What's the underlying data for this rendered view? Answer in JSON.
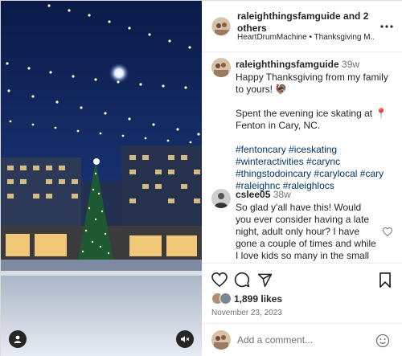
{
  "header": {
    "account": "raleighthingsfamguide",
    "and_others": "and 2 others",
    "subtitle": "HeartDrumMachine • Thanksgiving M..."
  },
  "caption": {
    "username": "raleighthingsfamguide",
    "time": "39w",
    "line1": "Happy Thanksgiving from my family to yours! 🦃",
    "line2": "Spent the evening ice skating at 📍 Fenton in Cary, NC.",
    "hashtags": [
      "#fentoncary",
      "#iceskating",
      "#winteractivities",
      "#carync",
      "#thingstodoincary",
      "#carylocal",
      "#cary",
      "#raleighnc",
      "#raleighlocs"
    ]
  },
  "comment": {
    "username": "cslee05",
    "time": "38w",
    "text": "So glad y'all have this! Would you ever consider having a late night, adult only hour? I have gone a couple of times and while I love kids so many in the small space gets me nervous."
  },
  "likes": {
    "count": "1,899 likes"
  },
  "date": "November 23, 2023",
  "add_comment": {
    "placeholder": "Add a comment..."
  },
  "colors": {
    "link": "#00376b",
    "text": "#262626",
    "muted": "#737373",
    "night_sky": "#0b1a3a"
  }
}
